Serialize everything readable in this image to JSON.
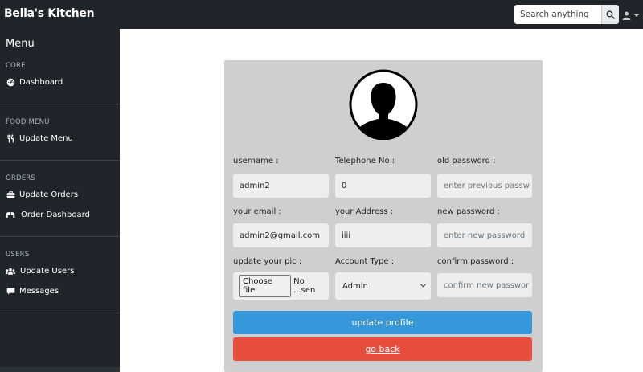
{
  "brand": "Bella's Kitchen",
  "search": {
    "placeholder": "Search anything"
  },
  "sidebar": {
    "title": "Menu",
    "sections": [
      {
        "heading": "CORE",
        "items": [
          {
            "label": "Dashboard",
            "icon": "tachometer-icon"
          }
        ]
      },
      {
        "heading": "FOOD MENU",
        "items": [
          {
            "label": "Update Menu",
            "icon": "utensils-icon"
          }
        ]
      },
      {
        "heading": "ORDERS",
        "items": [
          {
            "label": "Update Orders",
            "icon": "briefcase-icon"
          },
          {
            "label": "Order Dashboard",
            "icon": "hands-icon"
          }
        ]
      },
      {
        "heading": "USERS",
        "items": [
          {
            "label": "Update Users",
            "icon": "users-icon"
          },
          {
            "label": "Messages",
            "icon": "comment-icon"
          }
        ]
      }
    ]
  },
  "form": {
    "username": {
      "label": "username :",
      "value": "admin2"
    },
    "telephone": {
      "label": "Telephone No :",
      "value": "0"
    },
    "old_password": {
      "label": "old password :",
      "placeholder": "enter previous passw"
    },
    "email": {
      "label": "your email :",
      "value": "admin2@gmail.com"
    },
    "address": {
      "label": "your Address :",
      "value": "iiii"
    },
    "new_password": {
      "label": "new password :",
      "placeholder": "enter new password"
    },
    "pic": {
      "label": "update your pic :",
      "button": "Choose file",
      "status": "No ...sen"
    },
    "account_type": {
      "label": "Account Type :",
      "value": "Admin"
    },
    "confirm_password": {
      "label": "confirm password :",
      "placeholder": "confirm new passwor"
    },
    "update_button": "update profile",
    "back_button": "go back"
  },
  "colors": {
    "topbar": "#212529",
    "card": "#cfcfcf",
    "update_button": "#3498db",
    "back_button": "#e74c3c"
  }
}
